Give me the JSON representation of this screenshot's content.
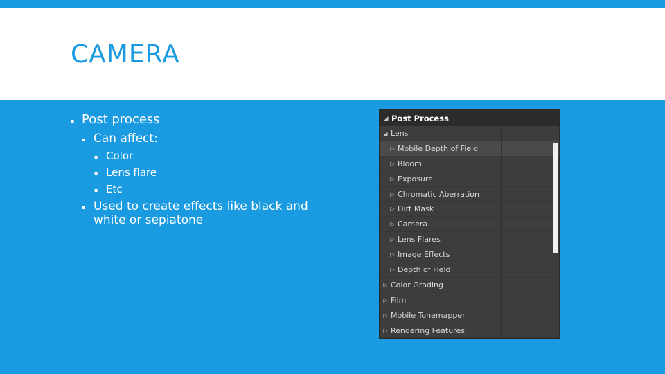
{
  "slide": {
    "title": "CAMERA",
    "bullets": {
      "post_process": "Post process",
      "can_affect": "Can affect:",
      "color": "Color",
      "lens_flare": "Lens flare",
      "etc": "Etc",
      "used_to_create": "Used to create effects like black and white or sepiatone"
    }
  },
  "panel": {
    "header": "Post Process",
    "rows": [
      {
        "label": "Lens",
        "expanded": true,
        "level": 1
      },
      {
        "label": "Mobile Depth of Field",
        "expanded": false,
        "level": 2,
        "selected": true
      },
      {
        "label": "Bloom",
        "expanded": false,
        "level": 2
      },
      {
        "label": "Exposure",
        "expanded": false,
        "level": 2
      },
      {
        "label": "Chromatic Aberration",
        "expanded": false,
        "level": 2
      },
      {
        "label": "Dirt Mask",
        "expanded": false,
        "level": 2
      },
      {
        "label": "Camera",
        "expanded": false,
        "level": 2
      },
      {
        "label": "Lens Flares",
        "expanded": false,
        "level": 2
      },
      {
        "label": "Image Effects",
        "expanded": false,
        "level": 2
      },
      {
        "label": "Depth of Field",
        "expanded": false,
        "level": 2
      },
      {
        "label": "Color Grading",
        "expanded": false,
        "level": 1
      },
      {
        "label": "Film",
        "expanded": false,
        "level": 1
      },
      {
        "label": "Mobile Tonemapper",
        "expanded": false,
        "level": 1
      },
      {
        "label": "Rendering Features",
        "expanded": false,
        "level": 1
      }
    ]
  },
  "colors": {
    "background": "#1a9ae0",
    "title_band": "#ffffff",
    "title_text": "#1a9ae0",
    "panel_bg": "#3d3d3d",
    "panel_header_bg": "#2b2b2b"
  }
}
